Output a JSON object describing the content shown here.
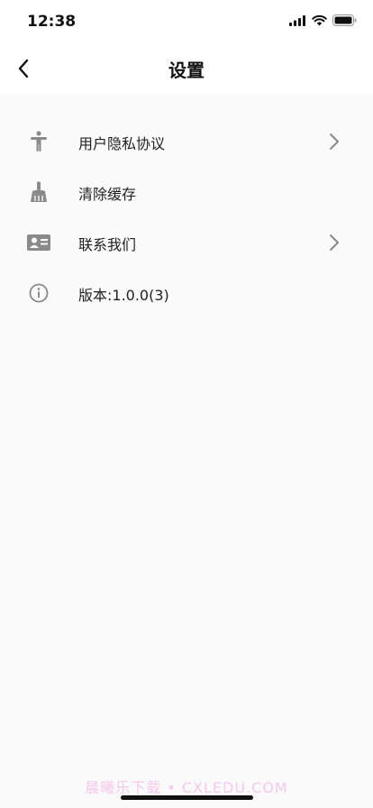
{
  "status_bar": {
    "time": "12:38"
  },
  "nav": {
    "title": "设置"
  },
  "settings": {
    "items": [
      {
        "label": "用户隐私协议",
        "icon": "accessibility-icon",
        "has_chevron": true
      },
      {
        "label": "清除缓存",
        "icon": "broom-icon",
        "has_chevron": false
      },
      {
        "label": "联系我们",
        "icon": "contact-card-icon",
        "has_chevron": true
      },
      {
        "label": "版本:1.0.0(3)",
        "icon": "info-icon",
        "has_chevron": false
      }
    ]
  },
  "watermark": "晨曦乐下载 • CXLEDU.COM",
  "colors": {
    "background": "#fafafa",
    "header": "#ffffff",
    "icon": "#8a8a8a",
    "chevron": "#8a8a8a",
    "watermark": "#f5c9ee"
  }
}
